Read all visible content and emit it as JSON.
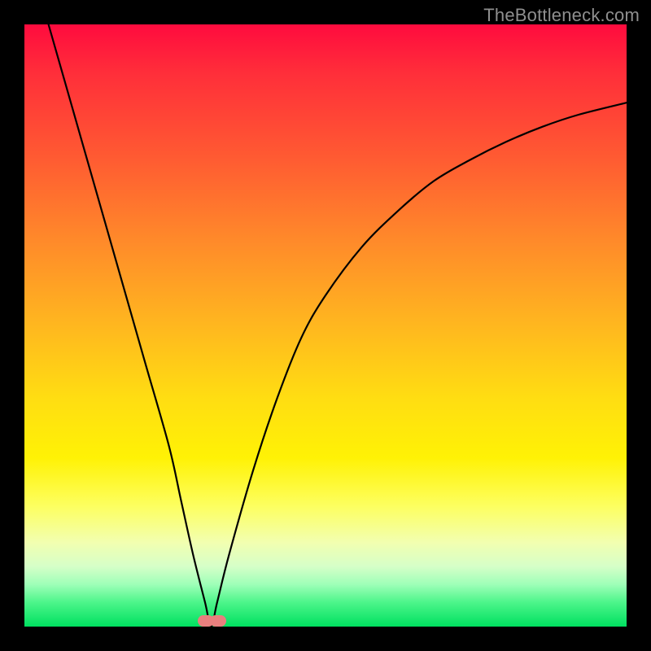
{
  "watermark": "TheBottleneck.com",
  "chart_data": {
    "type": "line",
    "title": "",
    "xlabel": "",
    "ylabel": "",
    "xlim": [
      0,
      100
    ],
    "ylim": [
      0,
      100
    ],
    "grid": false,
    "series": [
      {
        "name": "bottleneck-curve",
        "x": [
          4,
          8,
          12,
          16,
          20,
          24,
          26,
          28,
          30,
          31,
          32,
          34,
          38,
          42,
          46,
          50,
          56,
          62,
          68,
          74,
          80,
          86,
          92,
          100
        ],
        "y": [
          100,
          86,
          72,
          58,
          44,
          30,
          21,
          12,
          4,
          0,
          4,
          12,
          26,
          38,
          48,
          55,
          63,
          69,
          74,
          77.5,
          80.5,
          83,
          85,
          87
        ]
      }
    ],
    "markers": [
      {
        "name": "min-marker-left",
        "x": 30.2,
        "y": 1.0,
        "color": "#e97f7e"
      },
      {
        "name": "min-marker-right",
        "x": 32.2,
        "y": 1.0,
        "color": "#e97f7e"
      }
    ],
    "note": "Values are percentages read off the plot area; y is percent height from bottom, x is percent width from left. Curve descends steeply from top-left to a minimum near x≈31 then rises with diminishing slope toward x=100."
  }
}
